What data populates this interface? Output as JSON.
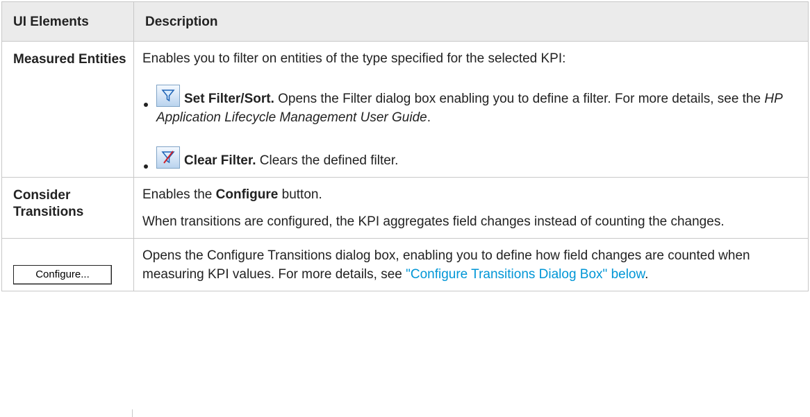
{
  "table": {
    "headers": [
      "UI Elements",
      "Description"
    ],
    "rows": {
      "measured": {
        "name": "Measured Entities",
        "intro": "Enables you to filter on entities of the type specified for the selected KPI:",
        "items": [
          {
            "icon": "filter-icon",
            "title": "Set Filter/Sort.",
            "text": " Opens the Filter dialog box enabling you to define a filter. For more details, see the ",
            "italic": "HP Application Lifecycle Management User Guide",
            "end": "."
          },
          {
            "icon": "clear-filter-icon",
            "title": "Clear Filter.",
            "text": " Clears the defined filter."
          }
        ]
      },
      "transitions": {
        "name": "Consider Transitions",
        "line1_pre": "Enables the ",
        "line1_bold": "Configure",
        "line1_post": " button.",
        "line2": "When transitions are configured, the KPI aggregates field changes instead of counting the changes."
      },
      "configure": {
        "button_label": "Configure...",
        "text": "Opens the Configure Transitions dialog box, enabling you to define how field changes are counted when measuring KPI values. For more details, see ",
        "link": "\"Configure Transitions Dialog Box\" below",
        "end": "."
      }
    }
  },
  "colors": {
    "header_bg": "#ebebeb",
    "link": "#0096d6",
    "border": "#c8c8c8"
  }
}
